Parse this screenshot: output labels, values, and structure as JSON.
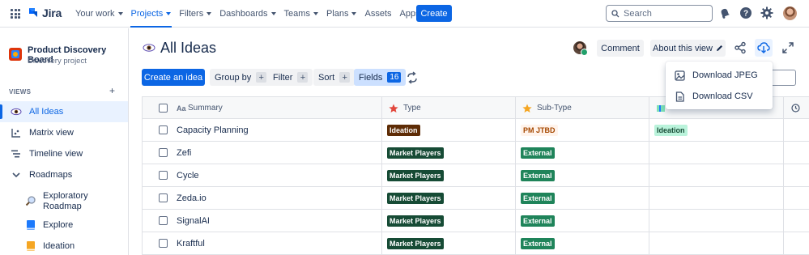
{
  "topnav": {
    "product": "Jira",
    "items": [
      {
        "label": "Your work",
        "dropdown": true,
        "active": false
      },
      {
        "label": "Projects",
        "dropdown": true,
        "active": true
      },
      {
        "label": "Filters",
        "dropdown": true,
        "active": false
      },
      {
        "label": "Dashboards",
        "dropdown": true,
        "active": false
      },
      {
        "label": "Teams",
        "dropdown": true,
        "active": false
      },
      {
        "label": "Plans",
        "dropdown": true,
        "active": false
      },
      {
        "label": "Assets",
        "dropdown": false,
        "active": false
      },
      {
        "label": "Apps",
        "dropdown": true,
        "active": false
      }
    ],
    "create_label": "Create",
    "search_placeholder": "Search",
    "icons": [
      "apps-grid-icon",
      "notifications-icon",
      "help-icon",
      "settings-icon",
      "user-avatar"
    ]
  },
  "sidebar": {
    "project_name": "Product Discovery Board",
    "project_type": "Discovery project",
    "views_label": "VIEWS",
    "views_add": "+",
    "items": [
      {
        "label": "All Ideas",
        "icon": "eye-icon",
        "active": true
      },
      {
        "label": "Matrix view",
        "icon": "matrix-icon",
        "active": false
      },
      {
        "label": "Timeline view",
        "icon": "timeline-icon",
        "active": false
      },
      {
        "label": "Roadmaps",
        "icon": "chevron-down-icon",
        "active": false
      },
      {
        "label": "Exploratory Roadmap",
        "icon": "magnifier-icon",
        "active": false
      },
      {
        "label": "Explore",
        "icon": "blue-book-icon",
        "active": false
      },
      {
        "label": "Ideation",
        "icon": "orange-book-icon",
        "active": false
      }
    ]
  },
  "header": {
    "title": "All Ideas",
    "comment_label": "Comment",
    "about_label": "About this view"
  },
  "toolbar": {
    "create_idea_label": "Create an idea",
    "group_by_label": "Group by",
    "filter_label": "Filter",
    "sort_label": "Sort",
    "fields_label": "Fields",
    "fields_count": "16",
    "plus": "+"
  },
  "export_menu": {
    "items": [
      {
        "label": "Download JPEG",
        "icon": "image-icon"
      },
      {
        "label": "Download CSV",
        "icon": "file-icon"
      }
    ]
  },
  "table": {
    "columns": [
      {
        "label": "Summary",
        "prefix": "Aa"
      },
      {
        "label": "Type",
        "icon": "star-icon"
      },
      {
        "label": "Sub-Type",
        "icon": "star-icon"
      }
    ],
    "rows": [
      {
        "summary": "Capacity Planning",
        "type": "Ideation",
        "subtype": "PM JTBD",
        "extra": "Ideation"
      },
      {
        "summary": "Zefi",
        "type": "Market Players",
        "subtype": "External",
        "extra": ""
      },
      {
        "summary": "Cycle",
        "type": "Market Players",
        "subtype": "External",
        "extra": ""
      },
      {
        "summary": "Zeda.io",
        "type": "Market Players",
        "subtype": "External",
        "extra": ""
      },
      {
        "summary": "SignalAI",
        "type": "Market Players",
        "subtype": "External",
        "extra": ""
      },
      {
        "summary": "Kraftful",
        "type": "Market Players",
        "subtype": "External",
        "extra": ""
      }
    ]
  },
  "colors": {
    "brand": "#0c66e4",
    "tag_ideation_bg": "#5e2c06",
    "tag_market_bg": "#164b35",
    "tag_external_bg": "#1f845a",
    "tag_pmjtbd_bg": "#fff3eb",
    "tag_pmjtbd_fg": "#a54800",
    "tag_ideation_light_bg": "#baf3db"
  }
}
